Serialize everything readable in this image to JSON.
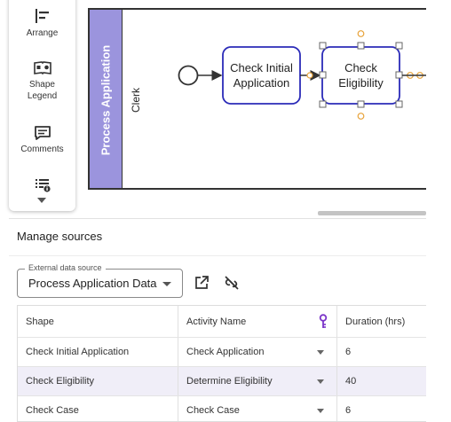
{
  "toolbar": {
    "items": [
      {
        "label": "Arrange",
        "icon": "arrange-icon"
      },
      {
        "label": "Shape Legend",
        "icon": "shape-legend-icon"
      },
      {
        "label": "Comments",
        "icon": "comments-icon"
      },
      {
        "label": "",
        "icon": "data-info-icon"
      }
    ],
    "more_icon": "chevron-down-icon"
  },
  "diagram": {
    "pool_title": "Process Application",
    "lane_title": "Clerk",
    "tasks": [
      {
        "label_lines": [
          "Check Initial",
          "Application"
        ]
      },
      {
        "label_lines": [
          "Check",
          "Eligibility"
        ]
      }
    ],
    "accent": "#2b2bb8",
    "pool_header_color": "#9b94dd",
    "handle_color": "#e8a33a"
  },
  "sources": {
    "title": "Manage sources",
    "external": {
      "legend": "External data source",
      "value": "Process Application Data"
    },
    "icons": {
      "open": "open-external-icon",
      "unlink": "unlink-icon"
    },
    "table": {
      "columns": [
        "Shape",
        "Activity Name",
        "Duration (hrs)"
      ],
      "key_icon": "key-icon",
      "rows": [
        {
          "shape": "Check Initial Application",
          "activity": "Check Application",
          "duration": "6"
        },
        {
          "shape": "Check Eligibility",
          "activity": "Determine Eligibility",
          "duration": "40"
        },
        {
          "shape": "Check Case",
          "activity": "Check Case",
          "duration": "6"
        }
      ]
    }
  }
}
